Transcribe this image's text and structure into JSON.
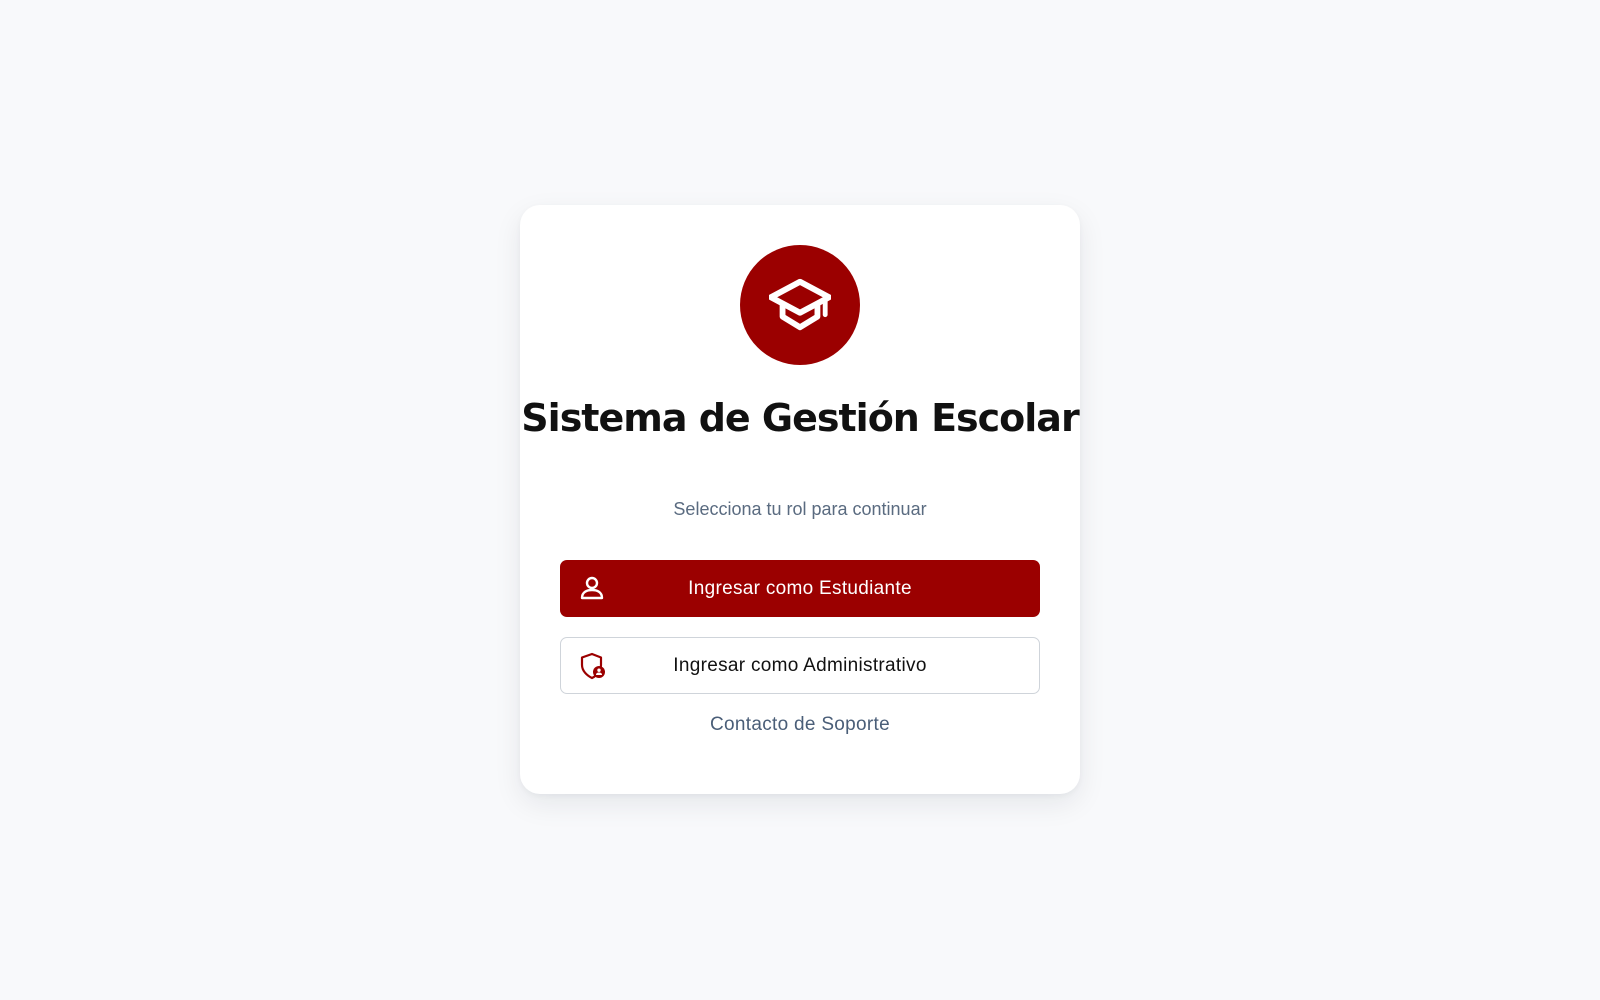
{
  "app": {
    "title": "Sistema de Gestión Escolar",
    "subtitle": "Selecciona tu rol para continuar"
  },
  "logo": {
    "icon": "graduation-cap-icon"
  },
  "actions": {
    "student": {
      "label": "Ingresar como Estudiante",
      "icon": "user-icon"
    },
    "admin": {
      "label": "Ingresar como Administrativo",
      "icon": "shield-user-icon"
    }
  },
  "support": {
    "label": "Contacto de Soporte"
  },
  "colors": {
    "brand": "#9b0000",
    "background": "#f8f9fb",
    "card": "#ffffff",
    "muted_text": "#5a6b80",
    "border": "#cfd4da"
  }
}
